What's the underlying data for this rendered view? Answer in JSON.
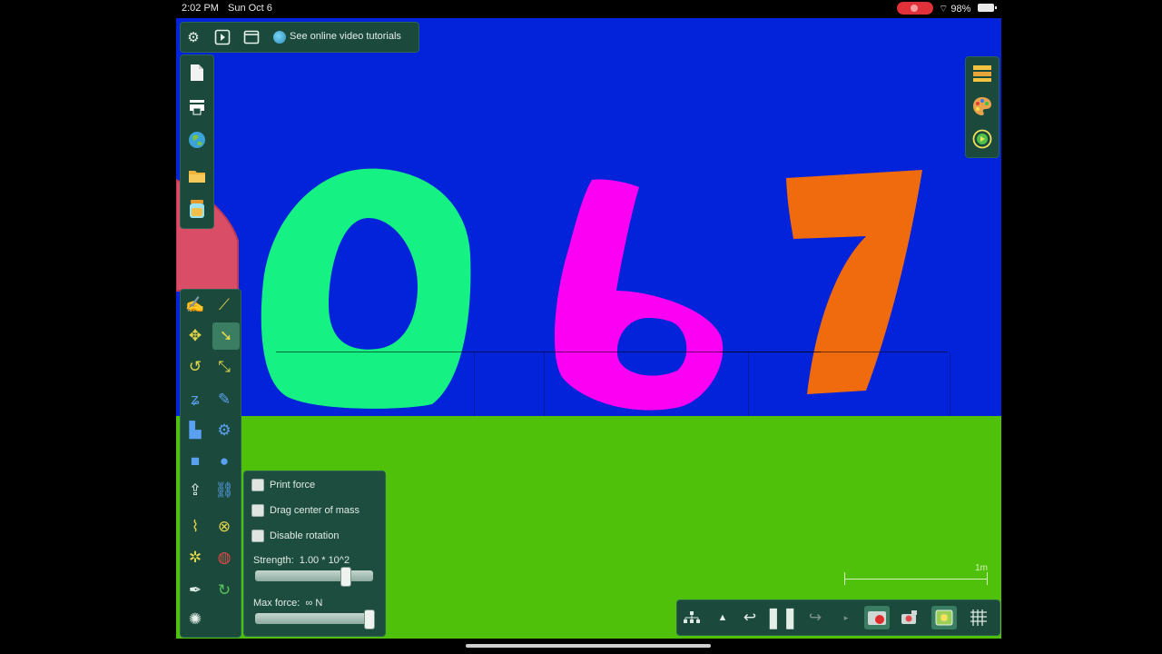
{
  "status_bar": {
    "time": "2:02 PM",
    "date": "Sun Oct 6",
    "battery": "98%"
  },
  "top_toolbar": {
    "settings_icon": "gear-icon",
    "run_icon": "play-square-icon",
    "window_icon": "window-icon",
    "tutorials_label": "See online video tutorials"
  },
  "file_panel": {
    "items": [
      "new-document-icon",
      "printer-icon",
      "globe-icon",
      "folder-icon",
      "jar-icon"
    ]
  },
  "right_panel": {
    "items": [
      "layers-icon",
      "palette-icon",
      "help-icon"
    ]
  },
  "tool_panel": {
    "selected_tool": "drag-tool"
  },
  "options_panel": {
    "print_force": "Print force",
    "drag_center_of_mass": "Drag center of mass",
    "disable_rotation": "Disable rotation",
    "strength_label": "Strength:",
    "strength_value": "1.00 * 10^2",
    "strength_fraction": 0.78,
    "max_force_label": "Max force:",
    "max_force_value": "∞",
    "max_force_unit": "N",
    "max_force_fraction": 1.0
  },
  "scale_bar": {
    "label": "1m"
  },
  "colors": {
    "sky": "#0223d9",
    "ground": "#4fc10a",
    "digit_zero": "#15f283",
    "digit_six": "#fc00f3",
    "digit_seven": "#f06a0e",
    "panel": "#1b4a3c",
    "side_object": "#d94e66"
  },
  "scene_objects": [
    "0",
    "6",
    "7"
  ]
}
